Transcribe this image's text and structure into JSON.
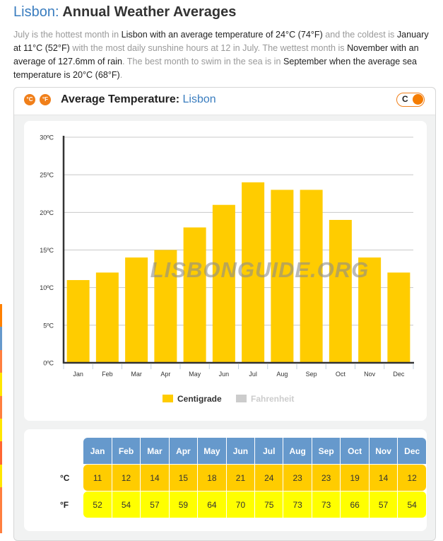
{
  "page": {
    "title_city": "Lisbon",
    "title_sep": ":",
    "title_rest": " Annual Weather Averages",
    "intro": [
      {
        "t": "July is the hottest month in ",
        "hl": false
      },
      {
        "t": "Lisbon with an average temperature of 24°C (74°F)",
        "hl": true
      },
      {
        "t": " and the coldest is ",
        "hl": false
      },
      {
        "t": "January at 11°C (52°F)",
        "hl": true
      },
      {
        "t": " with the most daily sunshine hours at 12 in July. The wettest month is ",
        "hl": false
      },
      {
        "t": "November with an average of 127.6mm of rain",
        "hl": true
      },
      {
        "t": ". The best month to swim in the sea is in ",
        "hl": false
      },
      {
        "t": "September when the average sea temperature is 20°C (68°F)",
        "hl": true
      },
      {
        "t": ".",
        "hl": false
      }
    ]
  },
  "side_strip_colors": [
    "#ff8000",
    "#6699cc",
    "#ff7f3f",
    "#ffe600",
    "#ff7f3f",
    "#ffe600",
    "#ff6633",
    "#ffe600",
    "#ff7f3f",
    "#ff7f3f"
  ],
  "card": {
    "icon_c": "°C",
    "icon_f": "°F",
    "title": "Average Temperature: ",
    "title_city": "Lisbon",
    "toggle_label": "C",
    "toggle_state": "C"
  },
  "colors": {
    "bar": "#ffcc00",
    "fahrenheit_legend": "#cccccc",
    "header_blue": "#6699cc",
    "row_c": "#ffcc00",
    "row_f": "#ffff00",
    "accent_orange": "#f57c00",
    "link_blue": "#3a7dbf"
  },
  "chart_data": {
    "type": "bar",
    "title": "Average Temperature: Lisbon",
    "categories": [
      "Jan",
      "Feb",
      "Mar",
      "Apr",
      "May",
      "Jun",
      "Jul",
      "Aug",
      "Sep",
      "Oct",
      "Nov",
      "Dec"
    ],
    "series": [
      {
        "name": "Centigrade",
        "values": [
          11,
          12,
          14,
          15,
          18,
          21,
          24,
          23,
          23,
          19,
          14,
          12
        ],
        "visible": true
      },
      {
        "name": "Fahrenheit",
        "values": [
          52,
          54,
          57,
          59,
          64,
          70,
          75,
          73,
          73,
          66,
          57,
          54
        ],
        "visible": false
      }
    ],
    "yticks": [
      0,
      5,
      10,
      15,
      20,
      25,
      30
    ],
    "ytick_suffix": "ºC",
    "ylim": [
      0,
      30
    ],
    "xlabel": "",
    "ylabel": "",
    "grid": true,
    "legend": "bottom",
    "watermark": "LISBONGUIDE.ORG"
  },
  "table": {
    "row_c_label": "°C",
    "row_f_label": "°F",
    "months": [
      "Jan",
      "Feb",
      "Mar",
      "Apr",
      "May",
      "Jun",
      "Jul",
      "Aug",
      "Sep",
      "Oct",
      "Nov",
      "Dec"
    ],
    "celsius": [
      11,
      12,
      14,
      15,
      18,
      21,
      24,
      23,
      23,
      19,
      14,
      12
    ],
    "fahrenheit": [
      52,
      54,
      57,
      59,
      64,
      70,
      75,
      73,
      73,
      66,
      57,
      54
    ]
  }
}
